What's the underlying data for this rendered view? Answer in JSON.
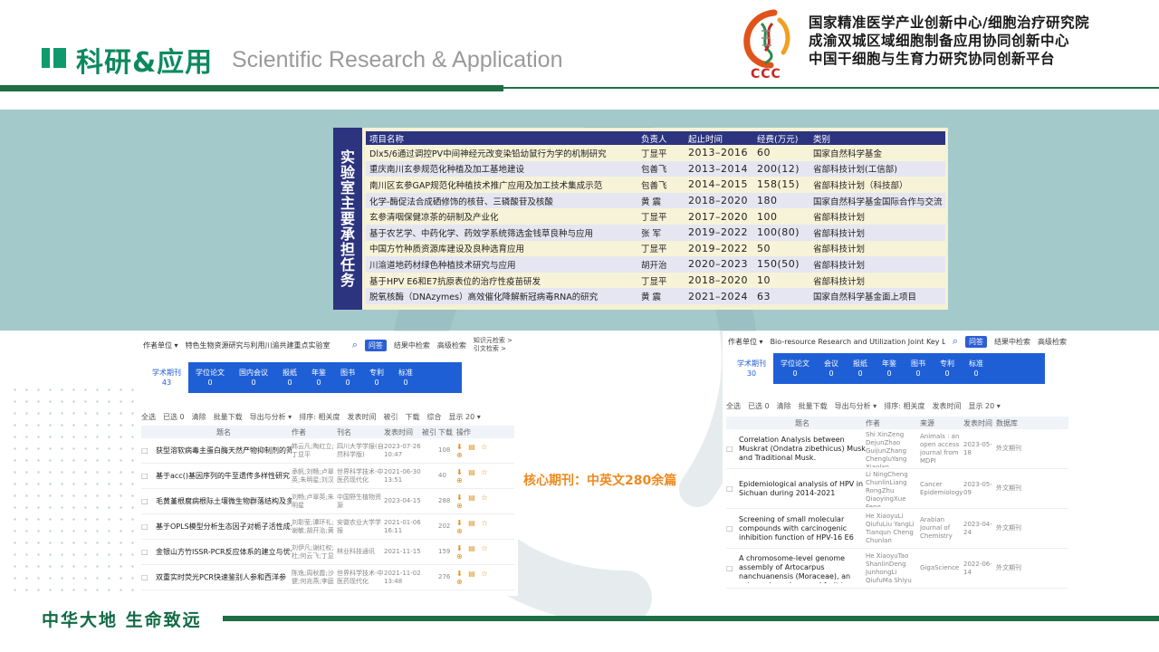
{
  "header": {
    "title": "科研&应用",
    "subtitle": "Scientific Research &  Application",
    "logo_text": "CCC",
    "org_lines": [
      "国家精准医学产业创新中心/细胞治疗研究院",
      "成渝双城区域细胞制备应用协同创新中心",
      "中国干细胞与生育力研究协同创新平台"
    ]
  },
  "projects": {
    "side_label": "实验室主要承担任务",
    "columns": [
      "项目名称",
      "负责人",
      "起止时间",
      "经费(万元)",
      "类别"
    ],
    "rows": [
      [
        "Dlx5/6通过调控PV中间神经元改变染铅幼鼠行为学的机制研究",
        "丁显平",
        "2013–2016",
        "60",
        "国家自然科学基金"
      ],
      [
        "重庆南川玄参规范化种植及加工基地建设",
        "包善飞",
        "2013–2014",
        "200(12)",
        "省部科技计划(工信部)"
      ],
      [
        "南川区玄参GAP规范化种植技术推广应用及加工技术集成示范",
        "包善飞",
        "2014–2015",
        "158(15)",
        "省部科技计划（科技部）"
      ],
      [
        "化学-酶促法合成硒修饰的核苷、三磷酸苷及核酸",
        "黄  震",
        "2018–2020",
        "180",
        "国家自然科学基金国际合作与交流"
      ],
      [
        "玄参清咽保健凉茶的研制及产业化",
        "丁显平",
        "2017–2020",
        "100",
        "省部科技计划"
      ],
      [
        "基于农艺学、中药化学、药效学系统筛选金钱草良种与应用",
        "张  军",
        "2019–2022",
        "100(80)",
        "省部科技计划"
      ],
      [
        "中国方竹种质资源库建设及良种选育应用",
        "丁显平",
        "2019–2022",
        "50",
        "省部科技计划"
      ],
      [
        "川渝道地药材绿色种植技术研究与应用",
        "胡开治",
        "2020–2023",
        "150(50)",
        "省部科技计划"
      ],
      [
        "基于HPV E6和E7抗原表位的治疗性疫苗研发",
        "丁显平",
        "2018–2020",
        "10",
        "省部科技计划"
      ],
      [
        "脱氧核酶（DNAzymes）高效催化降解新冠病毒RNA的研究",
        "黄  震",
        "2021–2024",
        "63",
        "国家自然科学基金面上项目"
      ]
    ]
  },
  "cnki_cn": {
    "field_select": "作者单位 ▾",
    "query": "特色生物资源研究与利用川渝共建重点实验室",
    "ask_btn": "问答",
    "links": [
      "结果中检索",
      "高级检索",
      "知识元检索 >",
      "引文检索 >"
    ],
    "tabs": [
      {
        "label": "学术期刊",
        "count": "43"
      },
      {
        "label": "学位论文",
        "count": "0"
      },
      {
        "label": "国内会议",
        "count": "0"
      },
      {
        "label": "报纸",
        "count": "0"
      },
      {
        "label": "年鉴",
        "count": "0"
      },
      {
        "label": "图书",
        "count": "0"
      },
      {
        "label": "专利",
        "count": "0"
      },
      {
        "label": "标准",
        "count": "0"
      }
    ],
    "toolbar": [
      "全选",
      "已选 0",
      "清除",
      "批量下载",
      "导出与分析 ▾",
      "排序: 相关度",
      "发表时间",
      "被引",
      "下载",
      "综合",
      "显示 20 ▾"
    ],
    "cols": [
      "题名",
      "作者",
      "刊名",
      "发表时间",
      "被引",
      "下载",
      "操作"
    ],
    "rows": [
      {
        "title": "获型溶软病毒主蛋白酶天然产物抑制剂的筛选",
        "author": "韩云凡;陶红立;丁显平",
        "journal": "四川大学学报(自然科学版)",
        "date": "2023-07-26 10:47",
        "dl": "108"
      },
      {
        "title": "基于acc()基因序列的牛至遗传多样性研究",
        "author": "承帆;刘畅;卢翠英;朱明星;刘汉",
        "journal": "世界科学技术-中医药现代化",
        "date": "2021-06-30 13:51",
        "dl": "40"
      },
      {
        "title": "毛黄堇根腐病根际土壤微生物群落结构及多样性",
        "author": "刘畅;卢翠英;朱明星",
        "journal": "中国野生植物资源",
        "date": "2023-04-15",
        "dl": "288"
      },
      {
        "title": "基于OPLS模型分析生态因子对栀子活性成分含量的影响",
        "author": "刘彰莹;谭环礼;谢敏;胡开治;黄三新",
        "journal": "安徽农业大学学报",
        "date": "2021-01-06 16:11",
        "dl": "202"
      },
      {
        "title": "金银山方竹ISSR-PCR反应体系的建立与优化",
        "author": "刘伊凡;谢红权;杜;何云飞;丁显平",
        "journal": "林业科技通讯",
        "date": "2021-11-15",
        "dl": "159"
      },
      {
        "title": "双重实时荧光PCR快速鉴别人参和西洋参",
        "author": "陈逸;周秋霞;沙健;何兆燕;李庭",
        "journal": "世界科学技术-中医药现代化",
        "date": "2021-11-02 13:48",
        "dl": "276"
      }
    ]
  },
  "cnki_en": {
    "field_select": "作者单位 ▾",
    "query": "Bio-resource Research and Utilization Joint Key Laboratory of Si",
    "ask_btn": "问答",
    "links": [
      "结果中检索",
      "高级检索"
    ],
    "tabs": [
      {
        "label": "学术期刊",
        "count": "30"
      },
      {
        "label": "学位论文",
        "count": "0"
      },
      {
        "label": "会议",
        "count": "0"
      },
      {
        "label": "报纸",
        "count": "0"
      },
      {
        "label": "年鉴",
        "count": "0"
      },
      {
        "label": "图书",
        "count": "0"
      },
      {
        "label": "专利",
        "count": "0"
      },
      {
        "label": "标准",
        "count": "0"
      }
    ],
    "toolbar": [
      "全选",
      "已选 0",
      "清除",
      "批量下载",
      "导出与分析 ▾",
      "排序: 相关度",
      "发表时间",
      "显示 20 ▾"
    ],
    "cols": [
      "题名",
      "作者",
      "来源",
      "发表时间",
      "数据库"
    ],
    "rows": [
      {
        "title": "Correlation Analysis between Muskrat (Ondatra zibethicus) Musk and Traditional Musk.",
        "author": "Shi XinZeng DejunZhao GuijunZhang ChengluYang Xiaolan",
        "source": "Animals : an open access journal from MDPI",
        "date": "2023-05-18",
        "db": "外文期刊"
      },
      {
        "title": "Epidemiological analysis of HPV in Sichuan during 2014-2021",
        "author": "Li NingCheng ChunlinLiang RongZhu QiaoyingXue Feng",
        "source": "Cancer Epidemiology",
        "date": "2023-05-09",
        "db": "外文期刊"
      },
      {
        "title": "Screening of small molecular compounds with carcinogenic inhibition function of HPV-16 E6",
        "author": "He XiaoyuLi QiufuLiu YangLi Tianqun Cheng Chunlan",
        "source": "Arabian Journal of Chemistry",
        "date": "2023-04-24",
        "db": "外文期刊"
      },
      {
        "title": "A chromosome-level genome assembly of Artocarpus nanchuanensis (Moraceae), an extremely endangered fruit tree.",
        "author": "He XiaoyuTao ShanlinDeng JunhongLi QiufuMa Shiyu",
        "source": "GigaScience",
        "date": "2022-06-14",
        "db": "外文期刊"
      }
    ]
  },
  "note": "核心期刊：中英文280余篇",
  "footer": {
    "slogan": "中华大地   生命致远"
  },
  "colors": {
    "brand_green": "#1f6e45",
    "title_green": "#0c8a5e",
    "band": "#a3c9cb",
    "table_header": "#2c3480",
    "note_orange": "#ef8a1e",
    "cnki_blue": "#1f5fd6"
  }
}
